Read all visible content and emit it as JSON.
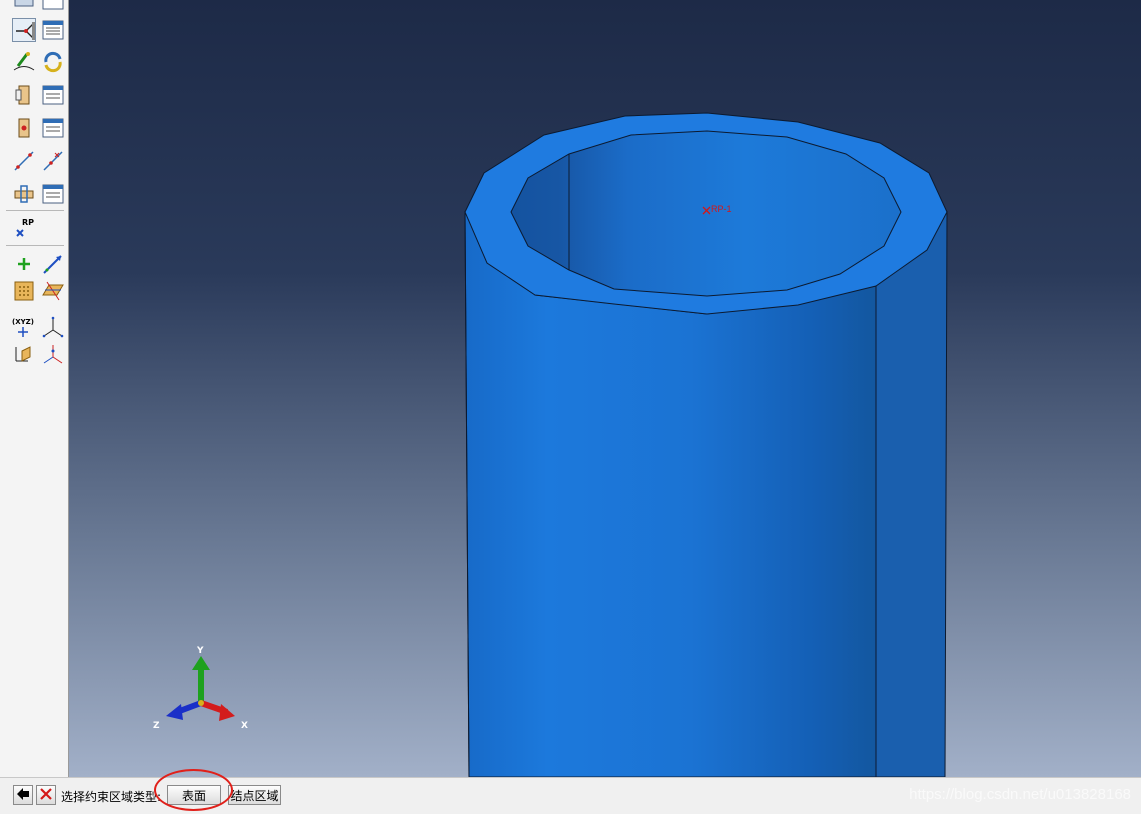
{
  "viewport": {
    "rp_label": "RP-1",
    "triad": {
      "x": "X",
      "y": "Y",
      "z": "Z"
    },
    "colors": {
      "part": "#1f7be0",
      "rp": "#d41818",
      "x_axis": "#d31c1c",
      "y_axis": "#1ea11e",
      "z_axis": "#1a2fc8"
    }
  },
  "toolbox": {
    "rp_label": "RP",
    "csys_label": "(XYZ)"
  },
  "prompt": {
    "text": "选择约束区域类型:",
    "options": [
      "表面",
      "结点区域"
    ],
    "highlight_color": "#e0201a"
  },
  "watermark": "https://blog.csdn.net/u013828168"
}
